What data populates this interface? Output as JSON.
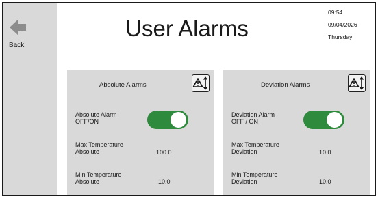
{
  "header": {
    "title": "User Alarms",
    "time": "09:54",
    "date": "09/04/2026",
    "weekday": "Thursday"
  },
  "sidebar": {
    "back_label": "Back",
    "back_icon": "arrow-left-icon"
  },
  "colors": {
    "sidebar_bg": "#d9d9d9",
    "panel_bg": "#d9d9d9",
    "toggle_on": "#2e8a3c"
  },
  "absolute_panel": {
    "title": "Absolute Alarms",
    "sort_icon": "alarm-sort-icon",
    "toggle_label_1": "Absolute Alarm",
    "toggle_label_2": "OFF/ON",
    "toggle_state": "on",
    "max_label_1": "Max Temperature",
    "max_label_2": "Absolute",
    "max_value": "100.0",
    "min_label_1": "Min Temperature",
    "min_label_2": "Absolute",
    "min_value": "10.0"
  },
  "deviation_panel": {
    "title": "Deviation Alarms",
    "sort_icon": "alarm-sort-icon",
    "toggle_label_1": "Deviation Alarm",
    "toggle_label_2": "OFF / ON",
    "toggle_state": "on",
    "max_label_1": "Max Temperature",
    "max_label_2": "Deviation",
    "max_value": "10.0",
    "min_label_1": "Min Temperature",
    "min_label_2": "Deviation",
    "min_value": "10.0"
  }
}
